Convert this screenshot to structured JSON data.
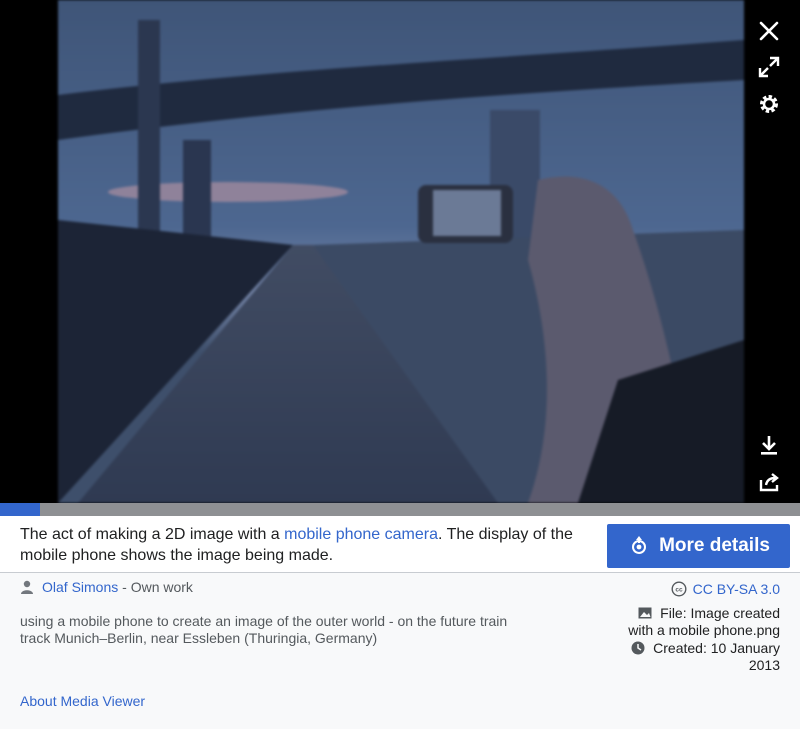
{
  "viewer": {
    "controls": {
      "close_icon": "close-icon",
      "fullscreen_icon": "fullscreen-icon",
      "settings_icon": "gear-icon",
      "download_icon": "download-icon",
      "share_icon": "share-icon"
    },
    "progress_fraction": 0.05,
    "accent": "#3366cc"
  },
  "caption": {
    "before": "The act of making a 2D image with a ",
    "link": "mobile phone camera",
    "after": ". The display of the mobile phone shows the image being made."
  },
  "more_details": {
    "label": "More details"
  },
  "author": {
    "name": "Olaf Simons",
    "suffix": " - Own work"
  },
  "description": "using a mobile phone to create an image of the outer world - on the future train track Munich–Berlin, near Essleben (Thuringia, Germany)",
  "license": {
    "label": "CC BY-SA 3.0"
  },
  "file": {
    "label": "File: Image created with a mobile phone.png"
  },
  "created": {
    "label": "Created: 10 January 2013"
  },
  "about": {
    "label": "About Media Viewer"
  }
}
